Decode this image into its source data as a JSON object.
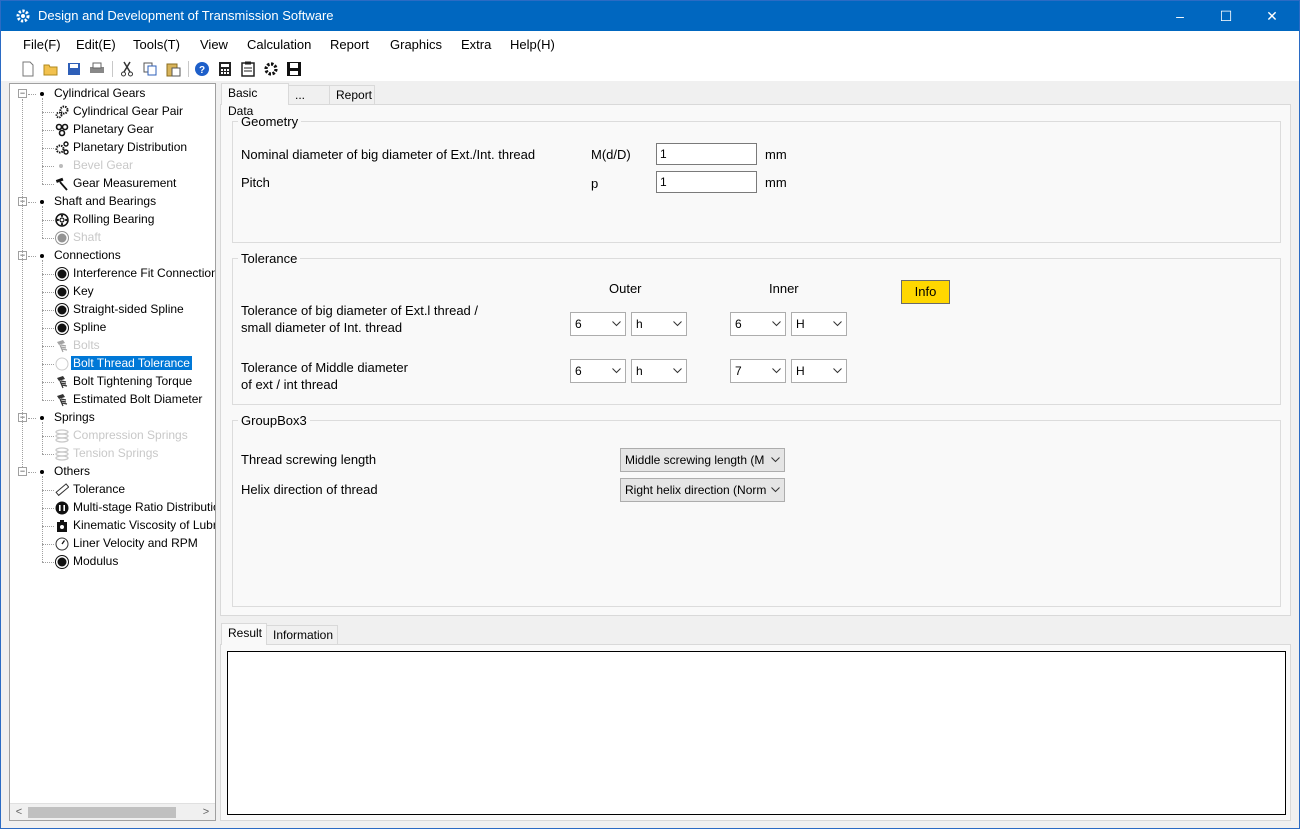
{
  "window": {
    "title": "Design and Development of Transmission Software",
    "controls": {
      "minimize": "–",
      "maximize": "☐",
      "close": "✕"
    }
  },
  "menu": [
    "File(F)",
    "Edit(E)",
    "Tools(T)",
    "View",
    "Calculation",
    "Report",
    "Graphics",
    "Extra",
    "Help(H)"
  ],
  "toolbar_icons": [
    "new-file-icon",
    "open-folder-icon",
    "save-icon",
    "print-icon",
    "cut-icon",
    "copy-icon",
    "paste-icon",
    "help-icon",
    "calculator-icon",
    "clipboard-icon",
    "gear-icon",
    "save-as-icon"
  ],
  "tree": {
    "nodes": [
      {
        "label": "Cylindrical Gears",
        "level": 0,
        "icon": "bullet"
      },
      {
        "label": "Cylindrical Gear Pair",
        "level": 1,
        "icon": "gear-pair-icon"
      },
      {
        "label": "Planetary Gear",
        "level": 1,
        "icon": "planetary-gear-icon"
      },
      {
        "label": "Planetary Distribution",
        "level": 1,
        "icon": "planetary-distribution-icon"
      },
      {
        "label": "Bevel Gear",
        "level": 1,
        "icon": "bullet",
        "disabled": true
      },
      {
        "label": "Gear Measurement",
        "level": 1,
        "icon": "hammer-icon"
      },
      {
        "label": "Shaft and Bearings",
        "level": 0,
        "icon": "bullet"
      },
      {
        "label": "Rolling Bearing",
        "level": 1,
        "icon": "bearing-icon"
      },
      {
        "label": "Shaft",
        "level": 1,
        "icon": "dot-icon",
        "disabled": true
      },
      {
        "label": "Connections",
        "level": 0,
        "icon": "bullet"
      },
      {
        "label": "Interference Fit Connection",
        "level": 1,
        "icon": "dot-icon"
      },
      {
        "label": "Key",
        "level": 1,
        "icon": "dot-icon"
      },
      {
        "label": "Straight-sided Spline",
        "level": 1,
        "icon": "dot-icon"
      },
      {
        "label": "Spline",
        "level": 1,
        "icon": "dot-icon"
      },
      {
        "label": "Bolts",
        "level": 1,
        "icon": "bolt-icon",
        "disabled": true
      },
      {
        "label": "Bolt Thread Tolerance",
        "level": 1,
        "icon": "circle-icon",
        "selected": true
      },
      {
        "label": "Bolt Tightening Torque",
        "level": 1,
        "icon": "bolt-icon"
      },
      {
        "label": "Estimated Bolt Diameter",
        "level": 1,
        "icon": "bolt-icon"
      },
      {
        "label": "Springs",
        "level": 0,
        "icon": "bullet"
      },
      {
        "label": "Compression Springs",
        "level": 1,
        "icon": "spring-icon",
        "disabled": true
      },
      {
        "label": "Tension Springs",
        "level": 1,
        "icon": "spring-icon",
        "disabled": true
      },
      {
        "label": "Others",
        "level": 0,
        "icon": "bullet"
      },
      {
        "label": "Tolerance",
        "level": 1,
        "icon": "ruler-icon"
      },
      {
        "label": "Multi-stage Ratio Distribution",
        "level": 1,
        "icon": "ratio-icon"
      },
      {
        "label": "Kinematic Viscosity of Lubricant",
        "level": 1,
        "icon": "oil-icon"
      },
      {
        "label": "Liner Velocity and RPM",
        "level": 1,
        "icon": "gauge-icon"
      },
      {
        "label": "Modulus",
        "level": 1,
        "icon": "dot-icon"
      }
    ]
  },
  "tabs_top": [
    "Basic Data",
    "...",
    "Report"
  ],
  "geometry": {
    "title": "Geometry",
    "rows": [
      {
        "label": "Nominal diameter of big diameter of Ext./Int. thread",
        "symbol": "M(d/D)",
        "value": "1",
        "unit": "mm"
      },
      {
        "label": "Pitch",
        "symbol": "p",
        "value": "1",
        "unit": "mm"
      }
    ]
  },
  "tolerance": {
    "title": "Tolerance",
    "outer_header": "Outer",
    "inner_header": "Inner",
    "info_button": "Info",
    "rows": [
      {
        "label_line1": "Tolerance of big diameter of Ext.l thread /",
        "label_line2": "small diameter of Int. thread",
        "outer_grade": "6",
        "outer_pos": "h",
        "inner_grade": "6",
        "inner_pos": "H"
      },
      {
        "label_line1": "Tolerance of Middle diameter",
        "label_line2": "of ext / int thread",
        "outer_grade": "6",
        "outer_pos": "h",
        "inner_grade": "7",
        "inner_pos": "H"
      }
    ]
  },
  "groupbox3": {
    "title": "GroupBox3",
    "rows": [
      {
        "label": "Thread screwing length",
        "value": "Middle screwing length (M"
      },
      {
        "label": "Helix direction of thread",
        "value": "Right helix direction (Norm"
      }
    ]
  },
  "tabs_bottom": [
    "Result",
    "Information"
  ],
  "colors": {
    "titlebar": "#0067c0",
    "selection": "#0078d7",
    "info_button": "#ffd700"
  }
}
